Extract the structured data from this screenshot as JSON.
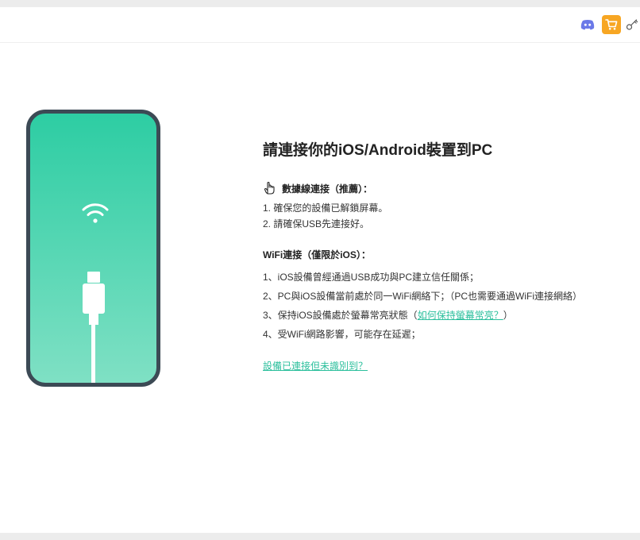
{
  "window": {
    "background": "#ffffff"
  },
  "titlebar": {
    "icons": [
      "discord-icon",
      "cart-icon",
      "key-icon"
    ],
    "accent": "#f7a623"
  },
  "illustration": {
    "phone_colors": {
      "top": "#2dcda3",
      "bottom": "#7fe0c4",
      "frame": "#3c4a55"
    },
    "icons": [
      "wifi-icon",
      "usb-cable-icon"
    ]
  },
  "main": {
    "title": "請連接你的iOS/Android裝置到PC",
    "usb_section": {
      "title": "數據線連接（推薦）：",
      "icon": "pointing-hand-icon",
      "steps": [
        "1. 確保您的設備已解鎖屏幕。",
        "2. 請確保USB先連接好。"
      ]
    },
    "wifi_section": {
      "title": "WiFi連接（僅限於iOS）：",
      "steps": [
        "1、iOS設備曾經通過USB成功與PC建立信任關係；",
        "2、PC與iOS設備當前處於同一WiFi網絡下；（PC也需要通過WiFi連接網絡）",
        "3、保持iOS設備處於螢幕常亮狀態（",
        "4、受WiFi網路影響，可能存在延遲；"
      ],
      "step3_link": "如何保持螢幕常亮？",
      "step3_suffix": "）"
    },
    "help_link": "設備已連接但未識別到？",
    "accent": "#2bbf9c"
  }
}
